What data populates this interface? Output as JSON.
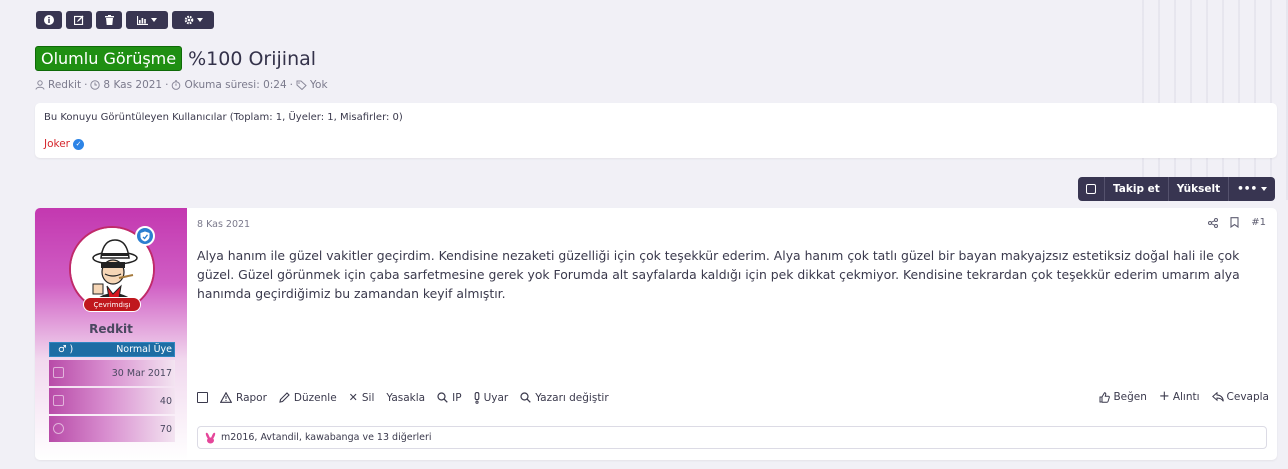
{
  "toolbar": {
    "icons": [
      "info-icon",
      "edit-icon",
      "trash-icon",
      "chart-icon",
      "gear-icon"
    ]
  },
  "thread": {
    "prefix": "Olumlu Görüşme",
    "title": "%100 Orijinal",
    "meta": {
      "author": "Redkit",
      "sep1": "·",
      "date": "8 Kas 2021",
      "sep2": "·",
      "reading_label": "Okuma süresi: 0:24",
      "sep3": "·",
      "tags": "Yok"
    }
  },
  "viewers": {
    "heading": "Bu Konuyu Görüntüleyen Kullanıcılar (Toplam: 1, Üyeler: 1, Misafirler: 0)",
    "user": "Joker",
    "user_color": "#d5262c"
  },
  "thread_actions": {
    "follow": "Takip et",
    "bump": "Yükselt",
    "more": "•••"
  },
  "post": {
    "date": "8 Kas 2021",
    "number": "#1",
    "body": "Alya hanım ile güzel vakitler geçirdim. Kendisine nezaketi güzelliği için çok teşekkür ederim. Alya hanım çok tatlı güzel bir bayan makyajzsız estetiksiz doğal hali ile çok güzel. Güzel görünmek için çaba sarfetmesine gerek yok Forumda alt sayfalarda kaldığı için pek dikkat çekmiyor. Kendisine tekrardan çok teşekkür ederim umarım alya hanımda geçirdiğimiz bu zamandan keyif almıştır.",
    "user": {
      "name": "Redkit",
      "status": "Çevrimdışı",
      "gender_symbol": "♂ )",
      "rank": "Normal Üye",
      "joined": "30 Mar 2017",
      "messages": "40",
      "reactions": "70"
    },
    "actions": {
      "report": "Rapor",
      "edit": "Düzenle",
      "delete": "Sil",
      "ban": "Yasakla",
      "ip": "IP",
      "warn": "Uyar",
      "change_author": "Yazarı değiştir"
    },
    "actions_right": {
      "like": "Beğen",
      "quote": "Alıntı",
      "reply": "Cevapla"
    },
    "reactions_text": "m2016, Avtandil, kawabanga ve 13 diğerleri"
  },
  "colors": {
    "accent_dark": "#383551",
    "prefix_green": "#1f8f12",
    "offline_red": "#c0171d"
  }
}
